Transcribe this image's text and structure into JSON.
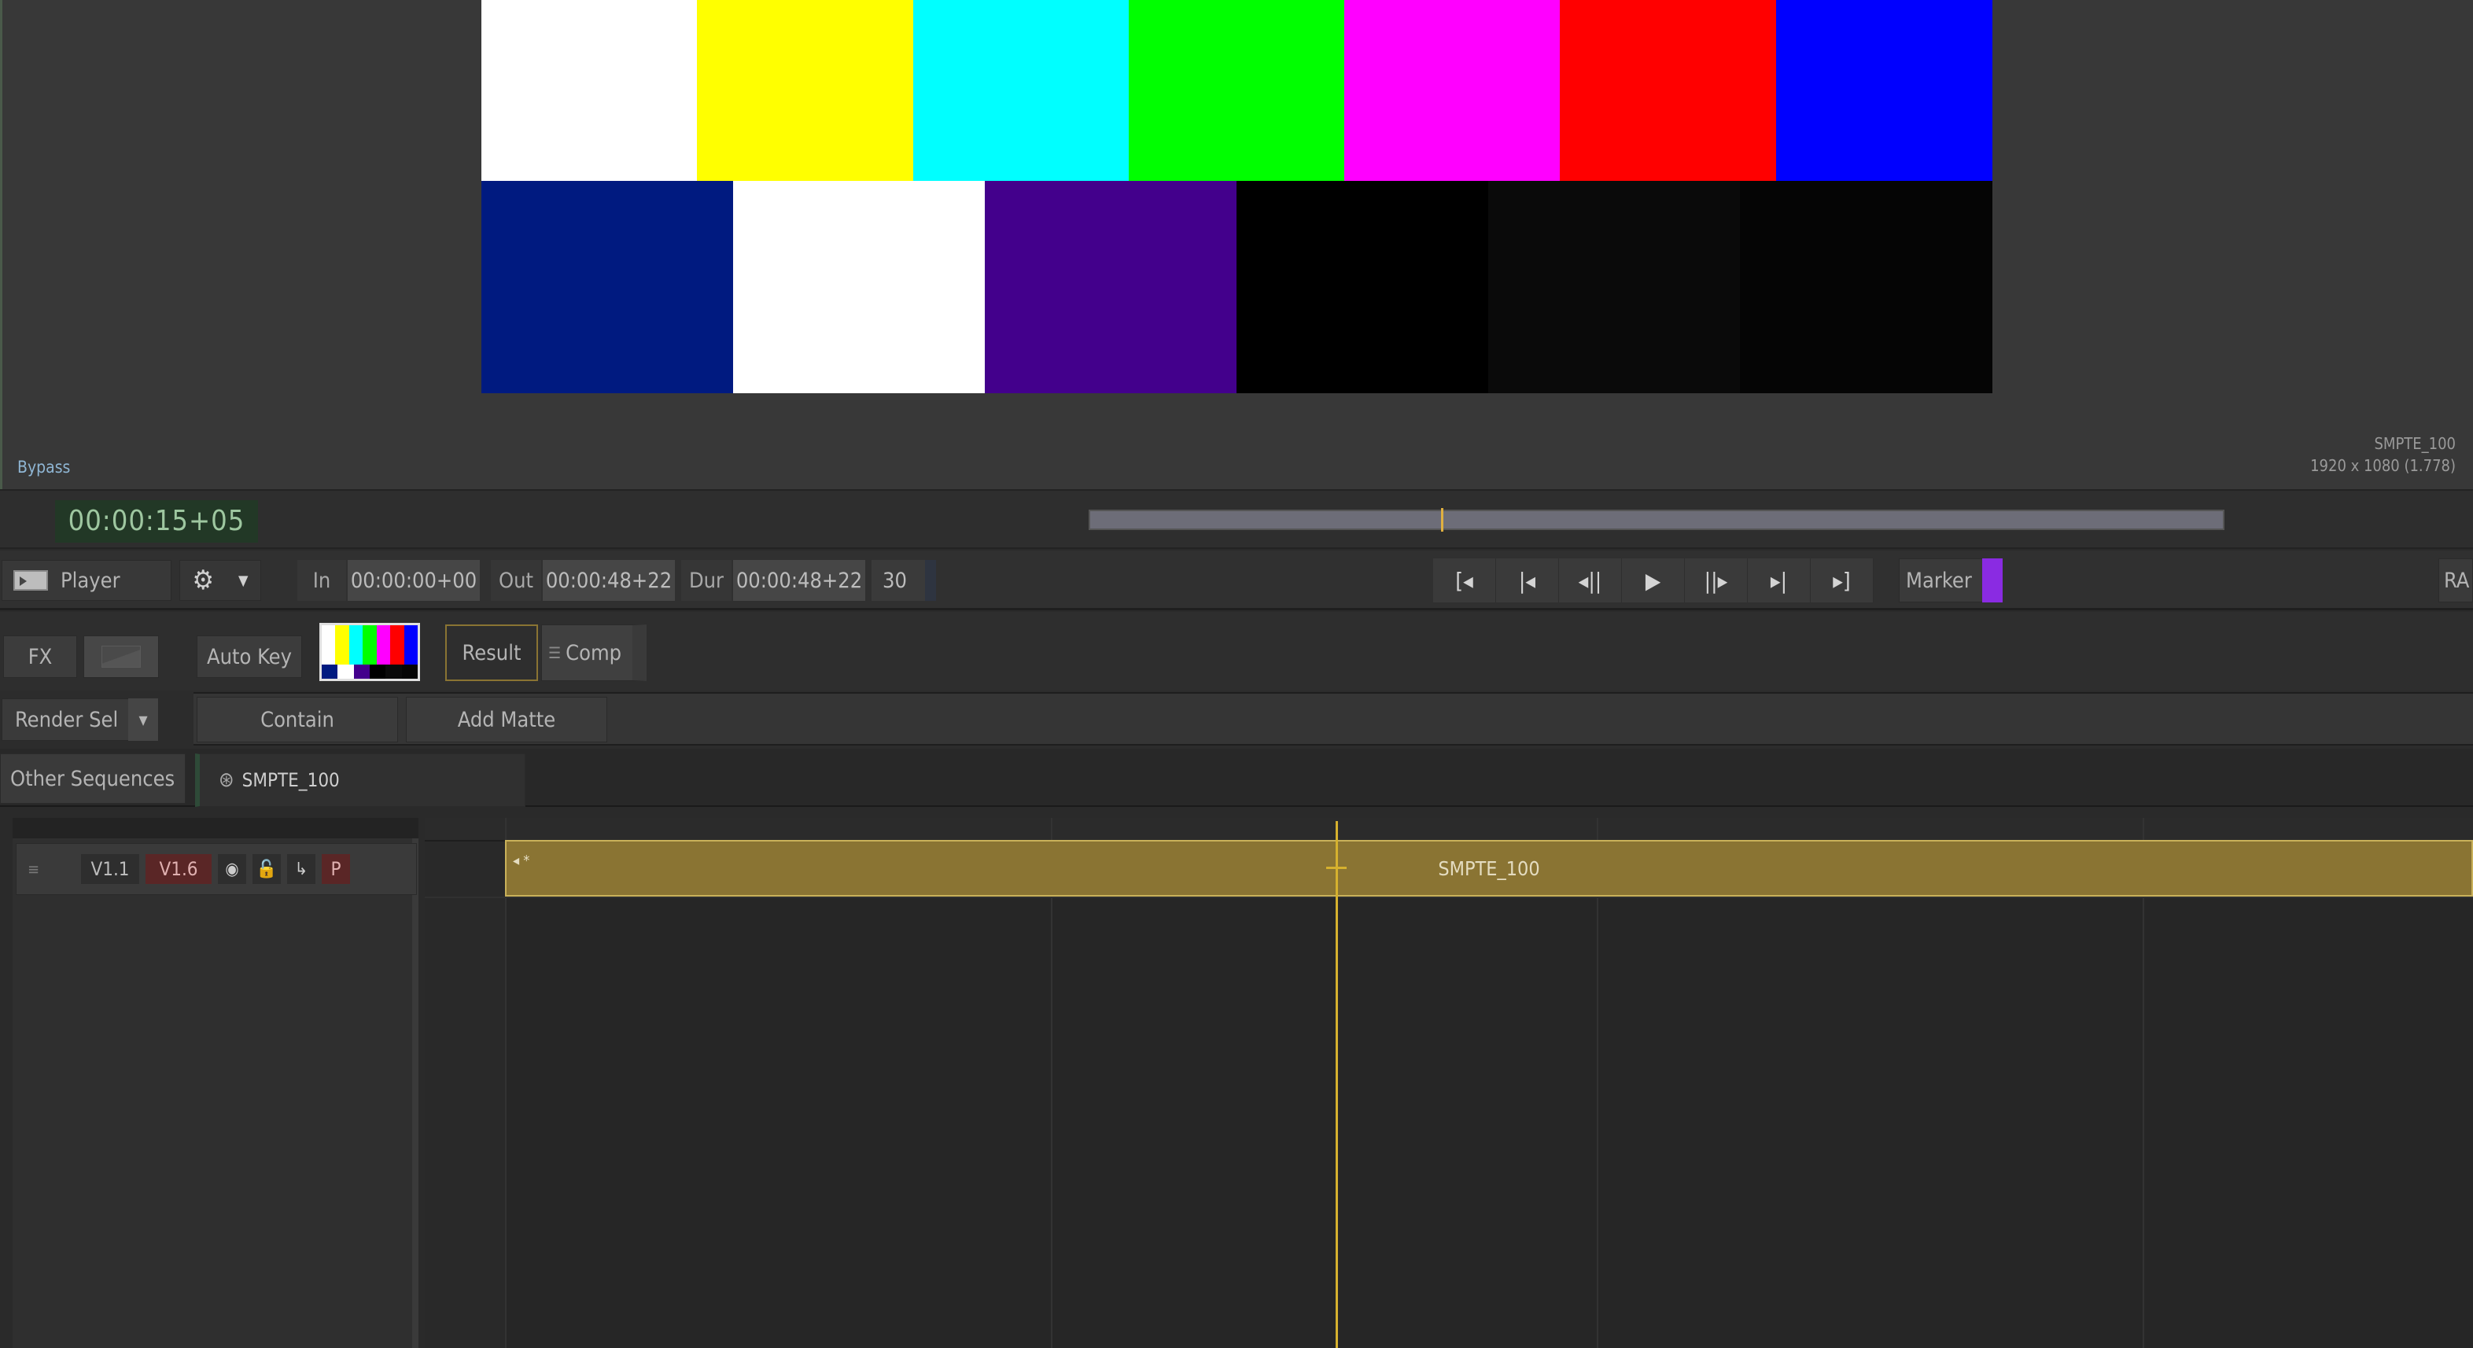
{
  "viewer": {
    "bypass_label": "Bypass",
    "clip_name": "SMPTE_100",
    "clip_resolution": "1920 x 1080 (1.778)",
    "bars_top": [
      "#ffffff",
      "#ffff00",
      "#00ffff",
      "#00ff00",
      "#ff00ff",
      "#ff0000",
      "#0000ff"
    ],
    "bars_bottom": [
      "#001a80",
      "#ffffff",
      "#43008c",
      "#000000",
      "#0a0a0a",
      "#050505"
    ]
  },
  "timecode": {
    "current": "00:00:15+05",
    "progress": 0.31
  },
  "player": {
    "mode_label": "Player",
    "in_label": "In",
    "in_value": "00:00:00+00",
    "out_label": "Out",
    "out_value": "00:00:48+22",
    "dur_label": "Dur",
    "dur_value": "00:00:48+22",
    "fps": "30",
    "marker_label": "Marker",
    "marker_color": "#8a2be2",
    "right_cut_label": "RA"
  },
  "fx": {
    "fx_label": "FX",
    "auto_key_label": "Auto Key",
    "result_label": "Result",
    "comp_label": "Comp",
    "render_sel_label": "Render Sel",
    "contain_label": "Contain",
    "add_matte_label": "Add Matte"
  },
  "tabs": {
    "other_sequences": "Other Sequences",
    "sequence_tab": "SMPTE_100"
  },
  "track": {
    "src_label": "V1.1",
    "dst_label": "V1.6",
    "p_label": "P",
    "clip_label": "SMPTE_100",
    "clip_marker": "*"
  }
}
